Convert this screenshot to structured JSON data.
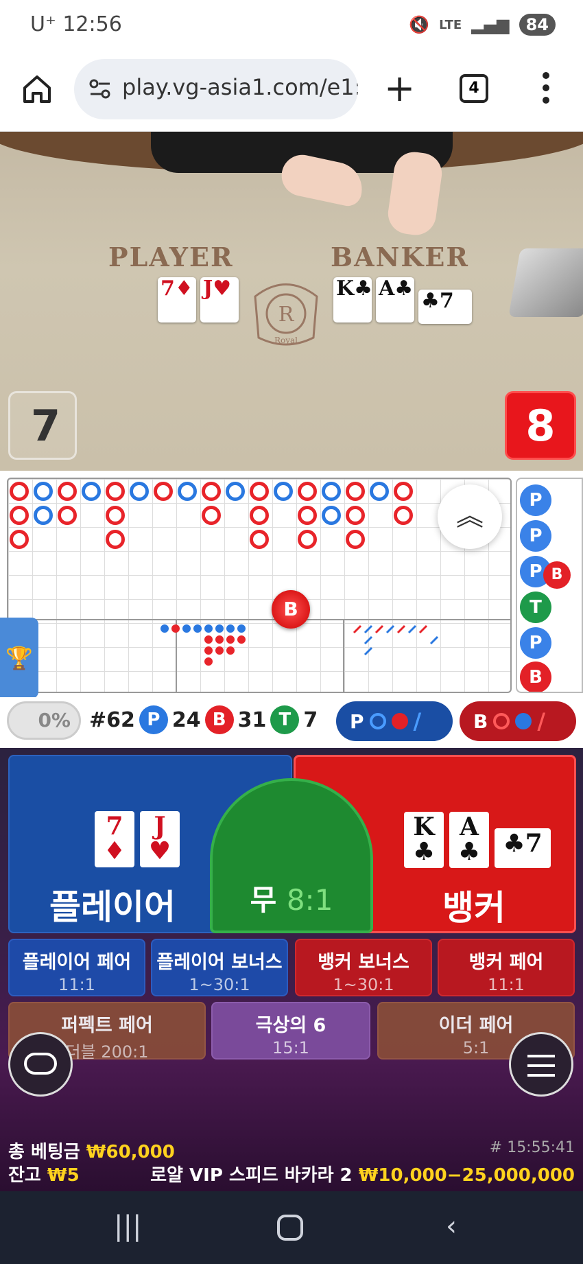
{
  "status_bar": {
    "carrier": "U⁺",
    "time": "12:56",
    "network": "LTE",
    "battery": "84"
  },
  "browser": {
    "url": "play.vg-asia1.com/e1:",
    "tab_count": "4"
  },
  "table": {
    "player_label": "PLAYER",
    "banker_label": "BANKER",
    "logo_text": "Royal",
    "player_cards": [
      {
        "rank": "7",
        "suit": "♦"
      },
      {
        "rank": "J",
        "suit": "♥"
      }
    ],
    "banker_cards": [
      {
        "rank": "K",
        "suit": "♣"
      },
      {
        "rank": "A",
        "suit": "♣"
      },
      {
        "rank": "7",
        "suit": "♣"
      }
    ],
    "player_total": "7",
    "banker_total": "8"
  },
  "roadmap": {
    "big_road_marker": "B",
    "side_beads": [
      "P",
      "P",
      "P",
      "T",
      "P",
      "B"
    ],
    "side_bead_extra": "B"
  },
  "stats": {
    "percent": "0%",
    "round": "#62",
    "player_label": "P",
    "player_count": "24",
    "banker_label": "B",
    "banker_count": "31",
    "tie_label": "T",
    "tie_count": "7",
    "ask_player": "P",
    "ask_banker": "B"
  },
  "bets": {
    "player": "플레이어",
    "tie": "무",
    "tie_odds": "8:1",
    "banker": "뱅커",
    "side": [
      {
        "label": "플레이어 페어",
        "odds": "11:1"
      },
      {
        "label": "플레이어 보너스",
        "odds": "1~30:1"
      },
      {
        "label": "뱅커 보너스",
        "odds": "1~30:1"
      },
      {
        "label": "뱅커 페어",
        "odds": "11:1"
      },
      {
        "label": "퍼펙트 페어",
        "odds": "더블 200:1"
      },
      {
        "label": "극상의 6",
        "odds": "15:1"
      },
      {
        "label": "이더 페어",
        "odds": "5:1"
      }
    ]
  },
  "footer": {
    "total_bet_label": "총 베팅금",
    "total_bet": "₩60,000",
    "balance_label": "잔고",
    "balance": "₩5",
    "round_time": "# 15:55:41",
    "table_name": "로얄 VIP 스피드 바카라 2",
    "limits": "₩10,000−25,000,000"
  },
  "colors": {
    "player": "#1a4ea4",
    "banker": "#d81818",
    "tie": "#1e8a30",
    "accent": "#ffd21e"
  }
}
